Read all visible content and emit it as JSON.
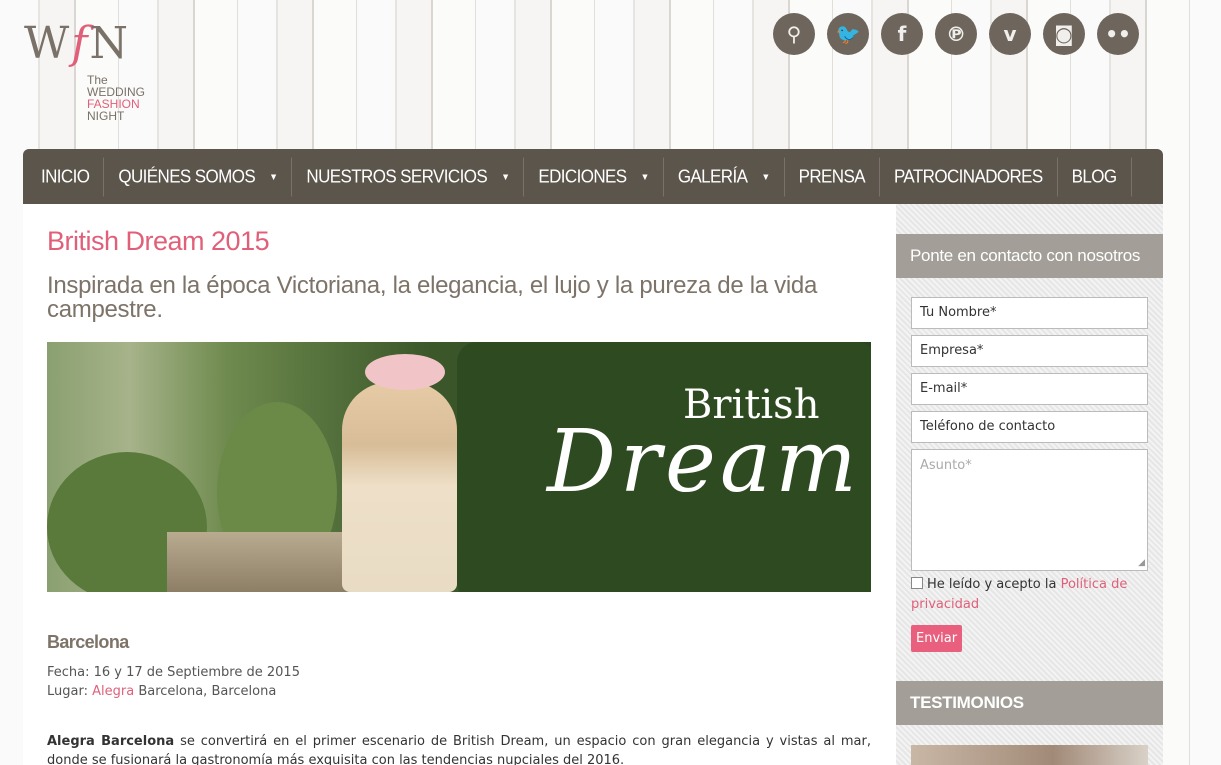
{
  "logo": {
    "w": "W",
    "f": "f",
    "n": "N",
    "line1": "The",
    "line2": "WEDDING",
    "line3": "FASHION",
    "line4": "NIGHT"
  },
  "social": [
    {
      "name": "search-icon",
      "glyph": "⚲"
    },
    {
      "name": "twitter-icon",
      "glyph": "🐦"
    },
    {
      "name": "facebook-icon",
      "glyph": "f"
    },
    {
      "name": "pinterest-icon",
      "glyph": "℗"
    },
    {
      "name": "vimeo-icon",
      "glyph": "v"
    },
    {
      "name": "instagram-icon",
      "glyph": "◙"
    },
    {
      "name": "flickr-icon",
      "glyph": "••"
    }
  ],
  "nav": {
    "inicio": "INICIO",
    "quienes": "QUIÉNES SOMOS",
    "servicios": "NUESTROS SERVICIOS",
    "ediciones": "EDICIONES",
    "galeria": "GALERÍA",
    "prensa": "PRENSA",
    "patrocinadores": "PATROCINADORES",
    "blog": "BLOG"
  },
  "main": {
    "title": "British Dream 2015",
    "tagline": "Inspirada en la época Victoriana, la elegancia, el lujo y la pureza de la vida campestre.",
    "hero_text1": "British",
    "hero_text2": "Dream",
    "location_heading": "Barcelona",
    "fecha_label": "Fecha: 16 y 17 de Septiembre de 2015",
    "lugar_label": "Lugar: ",
    "lugar_link": "Alegra",
    "lugar_rest": " Barcelona, Barcelona",
    "para_bold": "Alegra Barcelona",
    "para_text": " se convertirá en el primer escenario de British Dream, un espacio con gran elegancia y vistas al mar, donde se fusionará la gastronomía más exquisita con las tendencias nupciales del 2016."
  },
  "sidebar": {
    "contact_heading": "Ponte en contacto con nosotros",
    "nombre": "Tu Nombre*",
    "empresa": "Empresa*",
    "email": "E-mail*",
    "telefono": "Teléfono de contacto",
    "asunto": "Asunto*",
    "privacy_text": "He leído y acepto la ",
    "privacy_link": "Política de privacidad",
    "send": "Enviar",
    "testimonios": "TESTIMONIOS"
  },
  "colors": {
    "accent": "#e0607a",
    "nav_bg": "#5c554c",
    "panel_header": "#a39e97"
  }
}
